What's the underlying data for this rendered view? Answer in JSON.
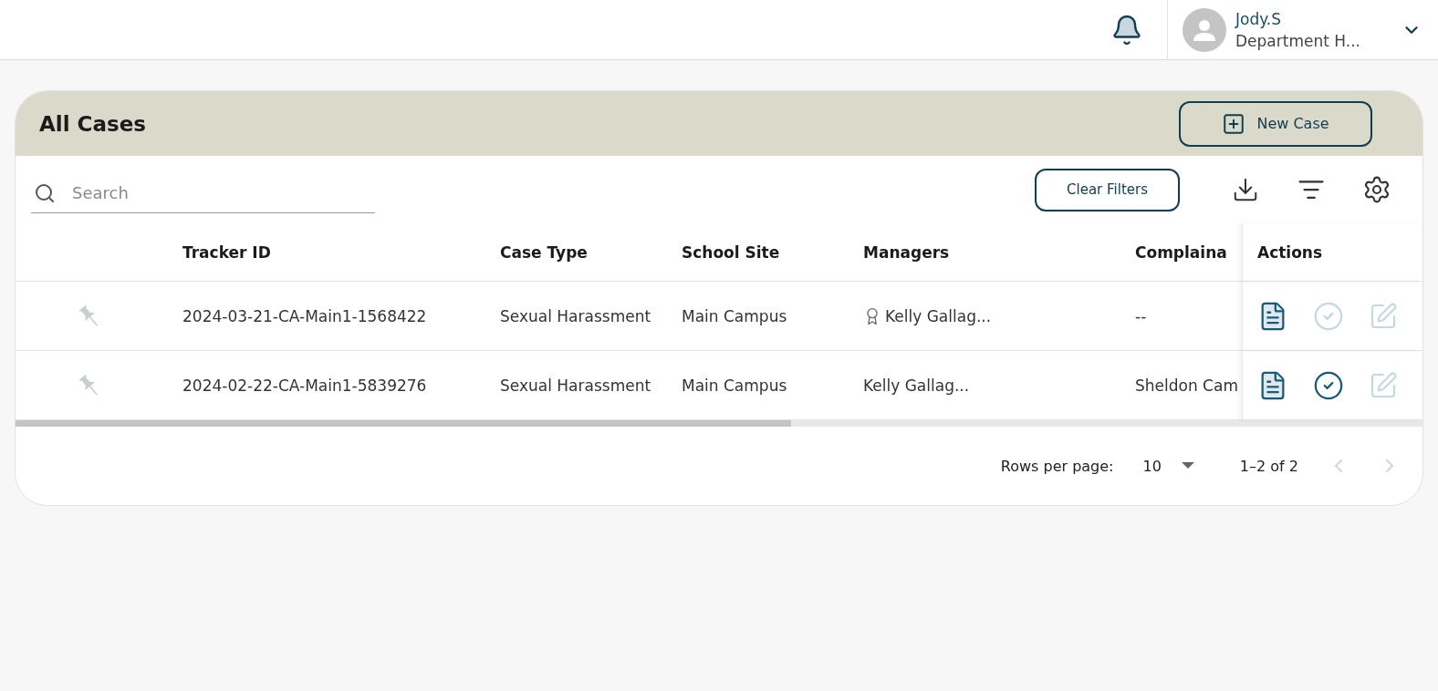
{
  "header": {
    "user": {
      "name": "Jody.S",
      "role": "Department H..."
    }
  },
  "card": {
    "title": "All Cases",
    "new_button": "New Case"
  },
  "toolbar": {
    "search": {
      "placeholder": "Search"
    },
    "clear_filters": "Clear Filters"
  },
  "table": {
    "columns": [
      "Tracker ID",
      "Case Type",
      "School Site",
      "Managers",
      "Complaina",
      "Actions"
    ],
    "rows": [
      {
        "pinned": false,
        "tracker_id": "2024-03-21-CA-Main1-1568422",
        "case_type": "Sexual Harassment",
        "school_site": "Main Campus",
        "manager": {
          "name": "Kelly Gallag...",
          "lead": true
        },
        "complainant": "--",
        "actions": {
          "view_enabled": true,
          "complete_enabled": false,
          "edit_enabled": false
        }
      },
      {
        "pinned": false,
        "tracker_id": "2024-02-22-CA-Main1-5839276",
        "case_type": "Sexual Harassment",
        "school_site": "Main Campus",
        "manager": {
          "name": "Kelly Gallag...",
          "lead": false
        },
        "complainant": "Sheldon Cam",
        "actions": {
          "view_enabled": true,
          "complete_enabled": true,
          "edit_enabled": false
        }
      }
    ]
  },
  "pagination": {
    "rows_per_page_label": "Rows per page:",
    "rows_per_page": "10",
    "range": "1–2 of 2",
    "prev_disabled": true,
    "next_disabled": true
  }
}
